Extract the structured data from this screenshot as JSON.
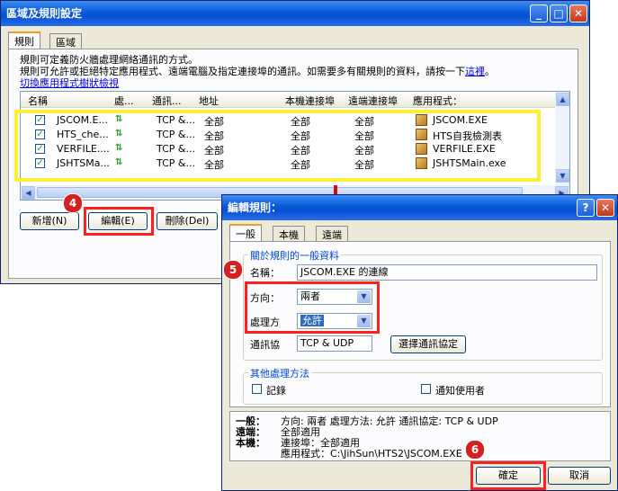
{
  "main_window": {
    "title": "區域及規則設定",
    "tabs": [
      "規則",
      "區域"
    ],
    "description_line1": "規則可定義防火牆處理網絡通訊的方式。",
    "description_line2": "規則可允許或拒絕特定應用程式、遠端電腦及指定連接埠的通訊。如需要多有關規則的資料，請按一下",
    "description_link": "這裡",
    "description_end": "。",
    "toggle_link": "切換應用程式樹狀檢視",
    "columns": [
      "名稱",
      "處...",
      "通訊...",
      "地址",
      "本機連接埠",
      "遠端連接埠",
      "應用程式："
    ],
    "rows": [
      {
        "name": "JSCOM.E...",
        "protocol": "TCP &...",
        "address": "全部",
        "local_port": "全部",
        "remote_port": "全部",
        "app": "JSCOM.EXE"
      },
      {
        "name": "HTS_che...",
        "protocol": "TCP &...",
        "address": "全部",
        "local_port": "全部",
        "remote_port": "全部",
        "app": "HTS自我檢測表"
      },
      {
        "name": "VERFILE....",
        "protocol": "TCP &...",
        "address": "全部",
        "local_port": "全部",
        "remote_port": "全部",
        "app": "VERFILE.EXE"
      },
      {
        "name": "JSHTSMa...",
        "protocol": "TCP &...",
        "address": "全部",
        "local_port": "全部",
        "remote_port": "全部",
        "app": "JSHTSMain.exe"
      }
    ],
    "buttons": {
      "add": "新增(N)",
      "edit": "編輯(E)",
      "delete": "刪除(Del)"
    }
  },
  "edit_dialog": {
    "title": "編輯規則：",
    "tabs": [
      "一般",
      "本機",
      "遠端"
    ],
    "group_general": "關於規則的一般資料",
    "name_label": "名稱：",
    "name_value": "JSCOM.EXE 的連線",
    "direction_label": "方向：",
    "direction_value": "兩者",
    "action_label": "處理方",
    "action_value": "允許",
    "protocol_label": "通訊協",
    "protocol_value": "TCP & UDP",
    "protocol_button": "選擇通訊協定",
    "group_other": "其他處理方法",
    "log_label": "記錄",
    "notify_label": "通知使用者",
    "summary": {
      "general_label": "一般：",
      "general_text": "方向: 兩者  處理方法: 允許  通訊協定: TCP & UDP",
      "remote_label": "遠端：",
      "remote_text": "全部適用",
      "local_label": "本機：",
      "local_port": "連接埠：全部適用",
      "local_app": "應用程式：C:\\JihSun\\HTS2\\JSCOM.EXE"
    },
    "ok": "確定",
    "cancel": "取消"
  },
  "annotations": {
    "step4": "4",
    "step5": "5",
    "step6": "6"
  },
  "colors": {
    "highlight_red": "#ff2020",
    "highlight_yellow": "#ffee33",
    "arrow_green": "#2a9a2a"
  }
}
